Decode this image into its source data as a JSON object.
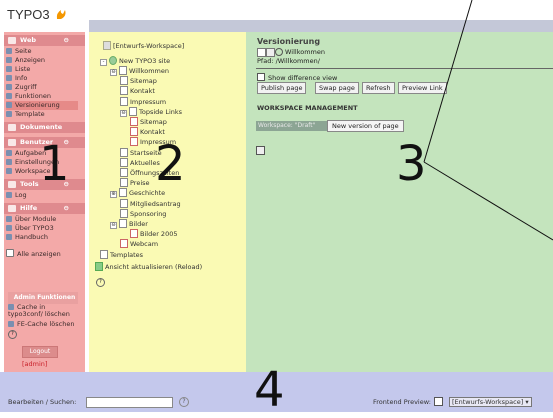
{
  "app": {
    "logo": "TYPO3"
  },
  "modules": {
    "groups": [
      {
        "name": "Web",
        "toggle": "⊖",
        "top": 0,
        "items": [
          "Seite",
          "Anzeigen",
          "Liste",
          "Info",
          "Zugriff",
          "Funktionen",
          "Versionierung",
          "Template"
        ],
        "selected": "Versionierung"
      },
      {
        "name": "Dokumente",
        "toggle": "",
        "items": []
      },
      {
        "name": "Benutzer",
        "toggle": "⊖",
        "items": [
          "Aufgaben",
          "Einstellungen",
          "Workspace"
        ]
      },
      {
        "name": "Tools",
        "toggle": "⊖",
        "items": [
          "Log"
        ]
      },
      {
        "name": "Hilfe",
        "toggle": "⊖",
        "items": [
          "Über Module",
          "Über TYPO3",
          "Handbuch"
        ]
      }
    ],
    "show_all": "Alle anzeigen",
    "admin_title": "Admin Funktionen",
    "cache_typo3conf": "Cache in typo3conf/ löschen",
    "cache_fe": "FE-Cache löschen",
    "logout": "Logout",
    "user": "[admin]"
  },
  "tree": {
    "workspace": "[Entwurfs-Workspace]",
    "root": "New TYPO3 site",
    "items": [
      {
        "label": "Willkommen",
        "toggle": "⊖"
      },
      {
        "label": "Sitemap"
      },
      {
        "label": "Kontakt"
      },
      {
        "label": "Impressum"
      },
      {
        "label": "Topside Links",
        "toggle": "⊖"
      },
      {
        "label": "Sitemap"
      },
      {
        "label": "Kontakt"
      },
      {
        "label": "Impressum"
      },
      {
        "label": "Startseite"
      },
      {
        "label": "Aktuelles"
      },
      {
        "label": "Öffnungszeiten"
      },
      {
        "label": "Preise"
      },
      {
        "label": "Geschichte",
        "toggle": "⊕"
      },
      {
        "label": "Mitgliedsantrag"
      },
      {
        "label": "Sponsoring"
      },
      {
        "label": "Bilder",
        "toggle": "⊖"
      },
      {
        "label": "Bilder 2005"
      },
      {
        "label": "Webcam"
      },
      {
        "label": "Templates"
      }
    ],
    "reload": "Ansicht aktualisieren (Reload)"
  },
  "content": {
    "title": "Versionierung",
    "page": "Willkommen",
    "path": "Pfad: /Willkommen/",
    "show_diff": "Show difference view",
    "buttons": [
      "Publish page",
      "Swap page",
      "Refresh",
      "Preview Link"
    ],
    "ws_management": "WORKSPACE MANAGEMENT",
    "ws_label": "Workspace: \"Draft\"",
    "new_version": "New version of page"
  },
  "bottom": {
    "edit_search": "Bearbeiten / Suchen:",
    "help": "?",
    "frontend_preview": "Frontend Preview:",
    "workspace": "[Entwurfs-Workspace]"
  },
  "annotations": [
    "1",
    "2",
    "3",
    "4"
  ],
  "colors": {
    "menu": "#f3a9a8",
    "tree": "#fafab4",
    "content": "#c4e4bd",
    "bottom": "#c4c8ec",
    "accent": "#df8a8e"
  }
}
